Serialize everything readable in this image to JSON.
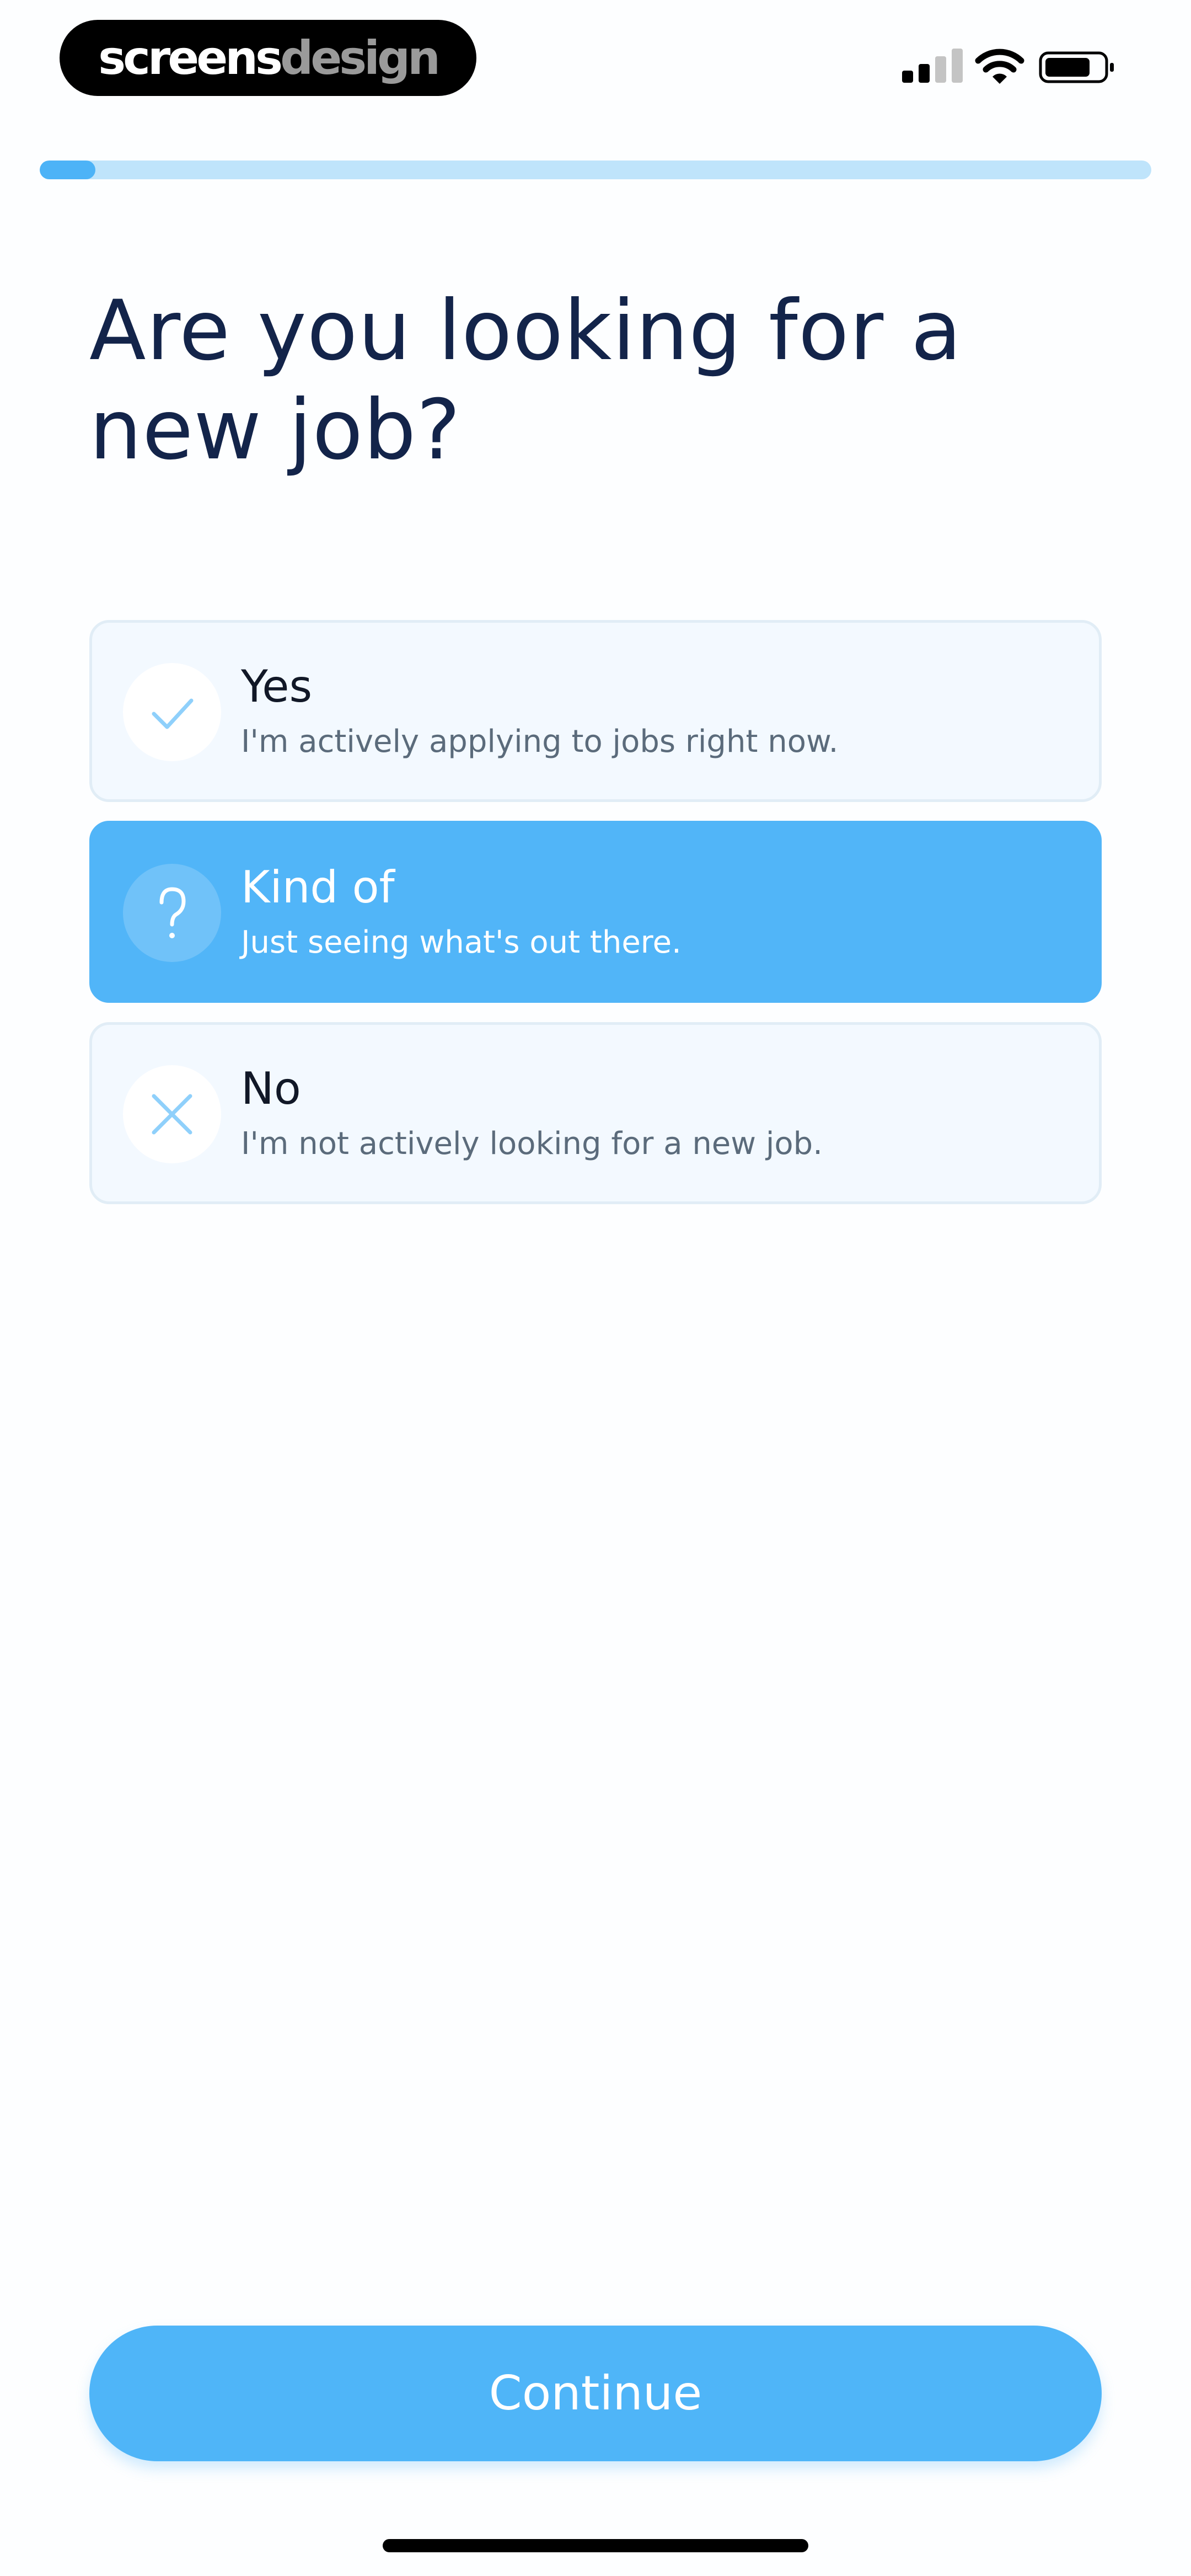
{
  "status_bar": {
    "brand_primary": "screens",
    "brand_secondary": "design",
    "icons": [
      "signal-icon",
      "wifi-icon",
      "battery-icon"
    ]
  },
  "progress": {
    "fraction": 0.05
  },
  "question": {
    "title": "Are you looking for a new job?"
  },
  "options": [
    {
      "icon": "checkmark-icon",
      "title": "Yes",
      "subtitle": "I'm actively applying to jobs right now.",
      "selected": false
    },
    {
      "icon": "question-mark-icon",
      "title": "Kind of",
      "subtitle": "Just seeing what's out there.",
      "selected": true
    },
    {
      "icon": "close-icon",
      "title": "No",
      "subtitle": "I'm not actively looking for a new job.",
      "selected": false
    }
  ],
  "actions": {
    "continue_label": "Continue"
  },
  "colors": {
    "accent": "#4fb5f8",
    "progress_track": "#bfe4fb",
    "title": "#13244a",
    "option_bg": "#f3f9ff",
    "option_border": "#e1edf6"
  }
}
